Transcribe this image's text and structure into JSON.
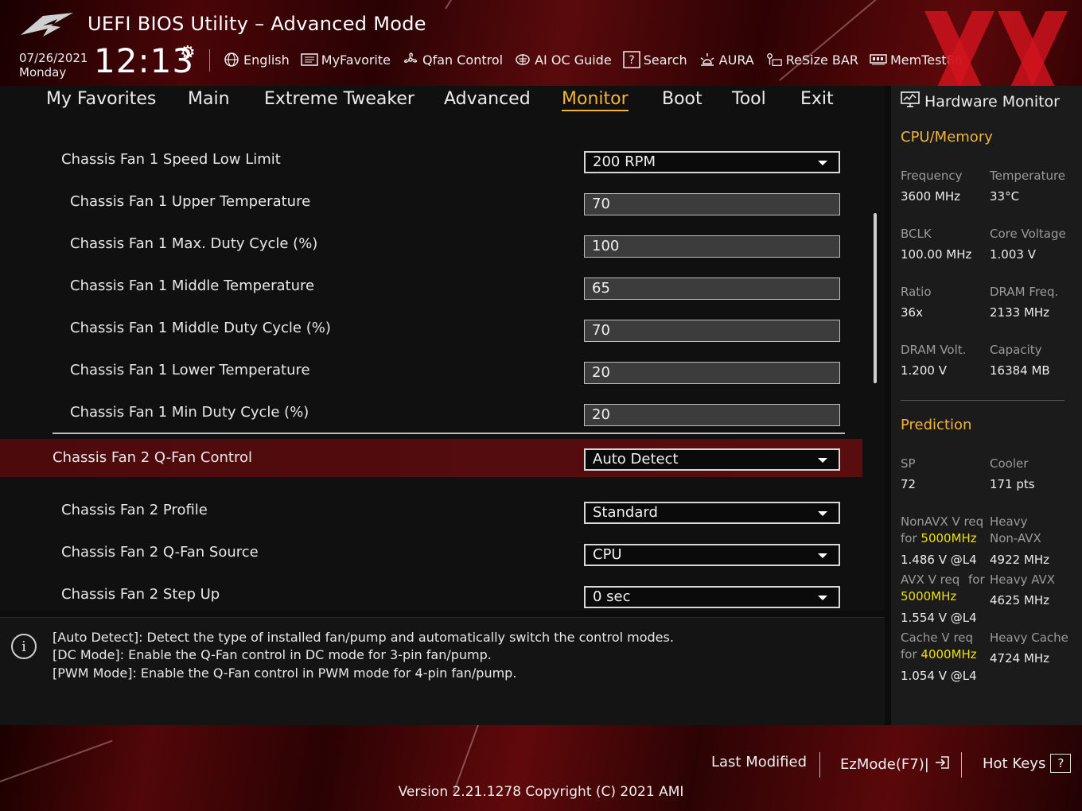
{
  "header": {
    "title": "UEFI BIOS Utility – Advanced Mode",
    "date": "07/26/2021",
    "day": "Monday",
    "time": "12:13",
    "logo_icon": "rog-eye-icon",
    "watermark_icon": "xx-watermark-icon",
    "toolbar": [
      {
        "label": "English",
        "icon": "globe-icon"
      },
      {
        "label": "MyFavorite",
        "icon": "favorite-list-icon"
      },
      {
        "label": "Qfan Control",
        "icon": "fan-icon"
      },
      {
        "label": "AI OC Guide",
        "icon": "ai-chip-icon"
      },
      {
        "label": "Search",
        "icon": "help-search-icon"
      },
      {
        "label": "AURA",
        "icon": "aura-light-icon"
      },
      {
        "label": "ReSize BAR",
        "icon": "resize-bar-icon"
      },
      {
        "label": "MemTest86",
        "icon": "memory-icon"
      }
    ]
  },
  "nav": {
    "tabs": [
      "My Favorites",
      "Main",
      "Extreme Tweaker",
      "Advanced",
      "Monitor",
      "Boot",
      "Tool",
      "Exit"
    ],
    "active": "Monitor"
  },
  "settings": [
    {
      "label": "Chassis Fan 1 Speed Low Limit",
      "value": "200 RPM",
      "kind": "select"
    },
    {
      "label": "Chassis Fan 1 Upper Temperature",
      "value": "70",
      "kind": "input"
    },
    {
      "label": "Chassis Fan 1 Max. Duty Cycle (%)",
      "value": "100",
      "kind": "input"
    },
    {
      "label": "Chassis Fan 1 Middle Temperature",
      "value": "65",
      "kind": "input"
    },
    {
      "label": "Chassis Fan 1 Middle Duty Cycle (%)",
      "value": "70",
      "kind": "input"
    },
    {
      "label": "Chassis Fan 1 Lower Temperature",
      "value": "20",
      "kind": "input"
    },
    {
      "label": "Chassis Fan 1 Min Duty Cycle (%)",
      "value": "20",
      "kind": "input"
    },
    {
      "label": "Chassis Fan 2 Q-Fan Control",
      "value": "Auto Detect",
      "kind": "select",
      "selected": true
    },
    {
      "label": "Chassis Fan 2 Profile",
      "value": "Standard",
      "kind": "select"
    },
    {
      "label": "Chassis Fan 2 Q-Fan Source",
      "value": "CPU",
      "kind": "select"
    },
    {
      "label": "Chassis Fan 2 Step Up",
      "value": "0 sec",
      "kind": "select"
    }
  ],
  "info": {
    "lines": [
      "[Auto Detect]: Detect the type of installed fan/pump and automatically switch the control modes.",
      "[DC Mode]: Enable the Q-Fan control in DC mode for 3-pin fan/pump.",
      "[PWM Mode]: Enable the Q-Fan control in PWM mode for 4-pin fan/pump."
    ]
  },
  "monitor": {
    "title": "Hardware Monitor",
    "cpu_section": "CPU/Memory",
    "cpu": {
      "frequency_label": "Frequency",
      "frequency": "3600 MHz",
      "temperature_label": "Temperature",
      "temperature": "33°C",
      "bclk_label": "BCLK",
      "bclk": "100.00 MHz",
      "core_voltage_label": "Core Voltage",
      "core_voltage": "1.003 V",
      "ratio_label": "Ratio",
      "ratio": "36x",
      "dram_freq_label": "DRAM Freq.",
      "dram_freq": "2133 MHz",
      "dram_volt_label": "DRAM Volt.",
      "dram_volt": "1.200 V",
      "capacity_label": "Capacity",
      "capacity": "16384 MB"
    },
    "prediction_section": "Prediction",
    "prediction": {
      "sp_label": "SP",
      "sp": "72",
      "cooler_label": "Cooler",
      "cooler": "171 pts",
      "nonavx_label1": "NonAVX V req",
      "nonavx_for": "for ",
      "nonavx_freq": "5000MHz",
      "heavy_nonavx_label1": "Heavy",
      "heavy_nonavx_label2": "Non-AVX",
      "nonavx_v": "1.486 V @L4",
      "heavy_nonavx": "4922 MHz",
      "avx_label1": "AVX V req",
      "avx_for": "for",
      "avx_freq": "5000MHz",
      "heavy_avx_label": "Heavy AVX",
      "heavy_avx": "4625 MHz",
      "avx_v": "1.554 V @L4",
      "cache_label1": "Cache V req",
      "cache_for": "for ",
      "cache_freq": "4000MHz",
      "heavy_cache_label": "Heavy Cache",
      "heavy_cache": "4724 MHz",
      "cache_v": "1.054 V @L4"
    }
  },
  "footer": {
    "last_modified": "Last Modified",
    "ezmode": "EzMode(F7)|",
    "hot_keys": "Hot Keys",
    "hot_keys_key": "?",
    "version": "Version 2.21.1278 Copyright (C) 2021 AMI"
  }
}
